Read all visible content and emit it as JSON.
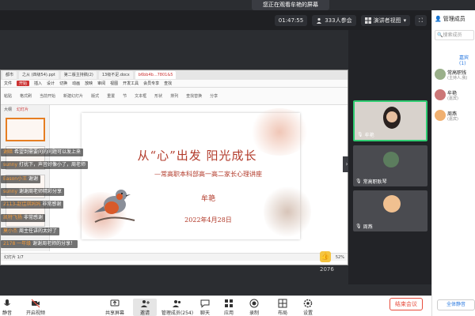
{
  "banner": "您正在观看牟艳的屏幕",
  "topbar": {
    "timer": "01:47:55",
    "attendees": "333人参会",
    "presenter_view": "演讲者视图",
    "manage_members": "管理成员"
  },
  "wps": {
    "tabs": [
      "都市",
      "之从 (四级54).ppt",
      "第二版主持稿(2)",
      "13级不足.docx",
      "b6bb4b...7801&5"
    ],
    "active_tab_index": 4,
    "menu": [
      "文件",
      "开始",
      "插入",
      "设计",
      "切换",
      "动画",
      "放映",
      "审阅",
      "视图",
      "开发工具",
      "会员专享",
      "查找"
    ],
    "ribbon": [
      "粘贴",
      "格式刷",
      "当前开始",
      "新建幻灯片",
      "版式",
      "重置",
      "节",
      "文本框",
      "形状",
      "排列",
      "查找替换",
      "分享"
    ],
    "thumb_tabs": [
      "大纲",
      "幻灯片"
    ],
    "status_left": "幻灯片 1/7",
    "status_right": "52%"
  },
  "slide": {
    "title": "从“心”出发  阳光成长",
    "subtitle": "—常高职本科部高一高二家长心理讲座",
    "author": "牟艳",
    "date": "2022年4月28日"
  },
  "chat": [
    {
      "user": "谢暗",
      "text": "希望到需要问的问题可以发上来"
    },
    {
      "user": "sunny",
      "text": "打扰下，声音好像小了，周老师"
    },
    {
      "user": "Eason小王",
      "text": "谢谢"
    },
    {
      "user": "sunny",
      "text": "谢谢周老师精彩分享"
    },
    {
      "user": "2113-赵佳琪妈妈",
      "text": "非常感谢"
    },
    {
      "user": "凯特飞扬",
      "text": "非常感谢"
    },
    {
      "user": "莫小杰",
      "text": "周主任讲的太好了"
    },
    {
      "user": "2178 一年级",
      "text": "谢谢周老师的分享！"
    }
  ],
  "view_count": "2076",
  "videos": [
    {
      "name": "牟艳",
      "active": true
    },
    {
      "name": "常高职耿琴",
      "active": false
    },
    {
      "name": "周燕",
      "active": false
    }
  ],
  "sidebar": {
    "search_placeholder": "搜索成员",
    "section_label": "嘉宾(1)",
    "members": [
      {
        "name": "常高职钱",
        "role": "(主持人,我)"
      },
      {
        "name": "牟艳",
        "role": "(嘉宾)"
      },
      {
        "name": "周燕",
        "role": "(嘉宾)"
      }
    ],
    "mute_all": "全体静音"
  },
  "bottombar": {
    "items": [
      "静音",
      "开启视频",
      "共享屏幕",
      "邀请",
      "管理成员(254)",
      "聊天",
      "应用",
      "录制",
      "布局",
      "设置"
    ],
    "leave": "结束会议"
  },
  "colors": {
    "accent_red": "#e74c3c",
    "slide_text": "#b23a2a",
    "active_speaker": "#2ecc71"
  }
}
